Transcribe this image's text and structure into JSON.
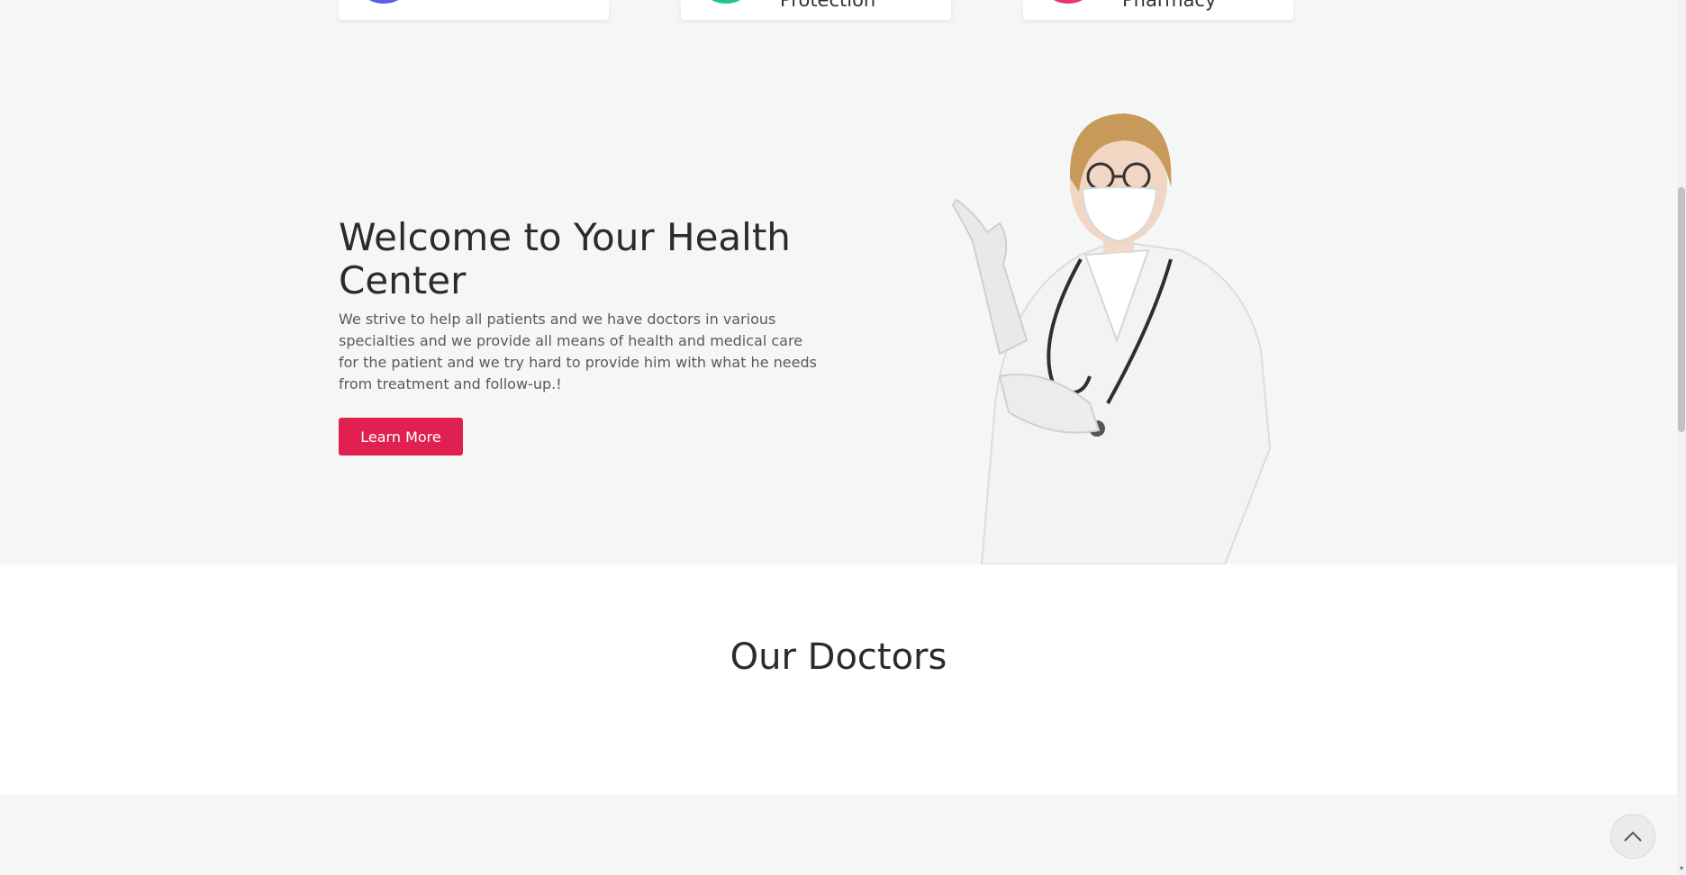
{
  "services": [
    {
      "label": "",
      "icon": "service-icon",
      "color": "#5b5bf0"
    },
    {
      "label": "Protection",
      "icon": "shield-icon",
      "color": "#1ec58a"
    },
    {
      "label": "Pharmacy",
      "icon": "pharmacy-icon",
      "color": "#e8337a"
    }
  ],
  "hero": {
    "title": "Welcome to Your Health Center",
    "text": "We strive to help all patients and we have doctors in various specialties and we provide all means of health and medical care for the patient and we try hard to provide him with what he needs from treatment and follow-up.!",
    "button_label": "Learn More",
    "accent": "#e0204f"
  },
  "doctors": {
    "title": "Our Doctors"
  },
  "back_to_top_icon": "chevron-up-icon"
}
